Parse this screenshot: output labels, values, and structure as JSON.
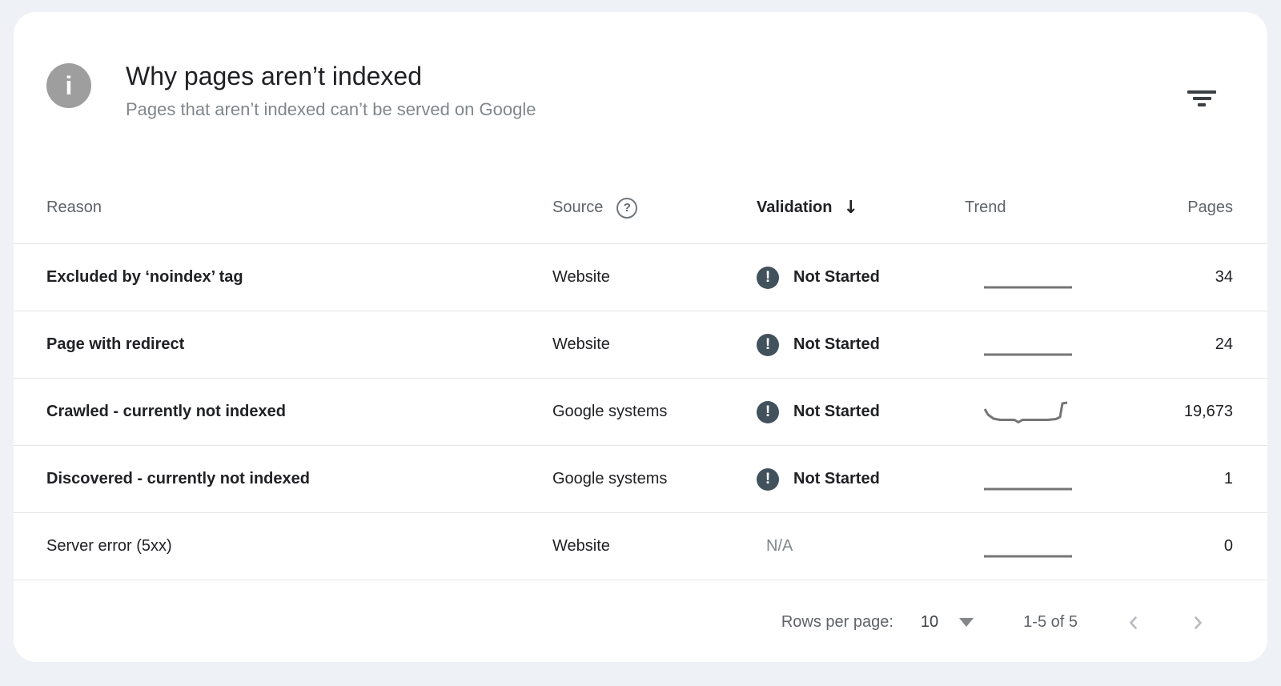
{
  "header": {
    "title": "Why pages aren’t indexed",
    "subtitle": "Pages that aren’t indexed can’t be served on Google"
  },
  "icons": {
    "info_glyph": "i",
    "help_glyph": "?",
    "sort_desc_glyph": "↓",
    "pending_glyph": "!",
    "filter_icon": "filter-bars",
    "rows_per_page_dropdown": "triangle-down",
    "prev_page": "chevron-left",
    "next_page": "chevron-right"
  },
  "colors": {
    "page_background": "#eef1f6",
    "card_background": "#ffffff",
    "validation_pending_badge": "#42525c",
    "spark_line": "#757575",
    "muted_text": "#80868b",
    "header_text": "#5f6368",
    "primary_text": "#202124"
  },
  "table": {
    "columns": {
      "reason": "Reason",
      "source": "Source",
      "validation": "Validation",
      "trend": "Trend",
      "pages": "Pages"
    },
    "sorted_by": "Validation",
    "rows": [
      {
        "reason": "Excluded by ‘noindex’ tag",
        "source": "Website",
        "validation": "Not Started",
        "validation_state": "pending",
        "trend": "flat",
        "pages": "34"
      },
      {
        "reason": "Page with redirect",
        "source": "Website",
        "validation": "Not Started",
        "validation_state": "pending",
        "trend": "flat",
        "pages": "24"
      },
      {
        "reason": "Crawled - currently not indexed",
        "source": "Google systems",
        "validation": "Not Started",
        "validation_state": "pending",
        "trend": "dip-spike",
        "pages": "19,673"
      },
      {
        "reason": "Discovered - currently not indexed",
        "source": "Google systems",
        "validation": "Not Started",
        "validation_state": "pending",
        "trend": "flat",
        "pages": "1"
      },
      {
        "reason": "Server error (5xx)",
        "source": "Website",
        "validation": "N/A",
        "validation_state": "none",
        "trend": "flat",
        "pages": "0"
      }
    ]
  },
  "footer": {
    "rows_per_page_label": "Rows per page:",
    "rows_per_page_value": "10",
    "range_label": "1-5 of 5"
  }
}
